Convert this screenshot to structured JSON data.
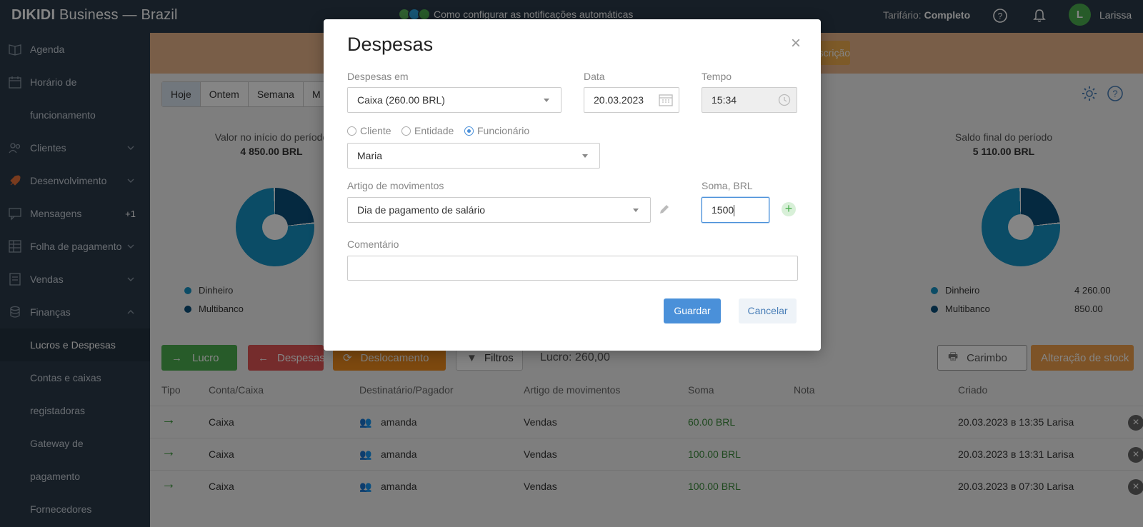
{
  "topbar": {
    "brand_name": "DIKIDI",
    "brand_suffix": " Business",
    "brand_separator": " — ",
    "brand_region": "Brazil",
    "notification_text": "Como configurar as notificações automáticas",
    "tarif_label": "Tarifário:",
    "tarif_value": "Completo",
    "avatar_letter": "L",
    "username": "Larissa"
  },
  "sidebar": {
    "items": [
      {
        "label": "Agenda"
      },
      {
        "label": "Horário de"
      },
      {
        "label": "funcionamento"
      },
      {
        "label": "Clientes"
      },
      {
        "label": "Desenvolvimento"
      },
      {
        "label": "Mensagens",
        "badge": "+1"
      },
      {
        "label": "Folha de pagamento"
      },
      {
        "label": "Vendas"
      },
      {
        "label": "Finanças"
      }
    ],
    "sub_items": [
      {
        "label": "Lucros e Despesas"
      },
      {
        "label": "Contas e caixas"
      },
      {
        "label": "registadoras"
      },
      {
        "label": "Gateway de"
      },
      {
        "label": "pagamento"
      },
      {
        "label": "Fornecedores"
      }
    ]
  },
  "main": {
    "banner_button": "Inscrição",
    "period_tabs": [
      "Hoje",
      "Ontem",
      "Semana",
      "M"
    ],
    "start_label": "Valor no início do período",
    "start_value": "4 850.00 BRL",
    "end_label": "Saldo final do período",
    "end_value": "5 110.00 BRL",
    "legend": [
      {
        "name": "Dinheiro",
        "color": "#1693c4",
        "value": "4 260.00"
      },
      {
        "name": "Multibanco",
        "color": "#0b4f7c",
        "value": "850.00"
      }
    ],
    "toolbar": {
      "lucro": "Lucro",
      "despesas": "Despesas",
      "deslocamento": "Deslocamento",
      "filtros": "Filtros",
      "total": "Lucro: 260,00",
      "carimbo": "Carimbo",
      "stock": "Alteração de stock"
    },
    "table": {
      "headers": [
        "Tipo",
        "Conta/Caixa",
        "Destinatário/Pagador",
        "Artigo de movimentos",
        "Soma",
        "Nota",
        "Criado"
      ],
      "rows": [
        {
          "conta": "Caixa",
          "dest": "amanda",
          "artigo": "Vendas",
          "soma": "60.00 BRL",
          "criado": "20.03.2023 в 13:35 Larisa"
        },
        {
          "conta": "Caixa",
          "dest": "amanda",
          "artigo": "Vendas",
          "soma": "100.00 BRL",
          "criado": "20.03.2023 в 13:31 Larisa"
        },
        {
          "conta": "Caixa",
          "dest": "amanda",
          "artigo": "Vendas",
          "soma": "100.00 BRL",
          "criado": "20.03.2023 в 07:30 Larisa"
        }
      ]
    }
  },
  "modal": {
    "title": "Despesas",
    "close": "×",
    "despesas_em_label": "Despesas em",
    "despesas_em_value": "Caixa (260.00 BRL)",
    "data_label": "Data",
    "data_value": "20.03.2023",
    "tempo_label": "Tempo",
    "tempo_value": "15:34",
    "radio_options": [
      "Cliente",
      "Entidade",
      "Funcionário"
    ],
    "radio_selected": "Funcionário",
    "person_value": "Maria",
    "artigo_label": "Artigo de movimentos",
    "artigo_value": "Dia de pagamento de salário",
    "soma_label": "Soma, BRL",
    "soma_value": "1500",
    "comentario_label": "Comentário",
    "comentario_value": "",
    "guardar": "Guardar",
    "cancelar": "Cancelar"
  }
}
